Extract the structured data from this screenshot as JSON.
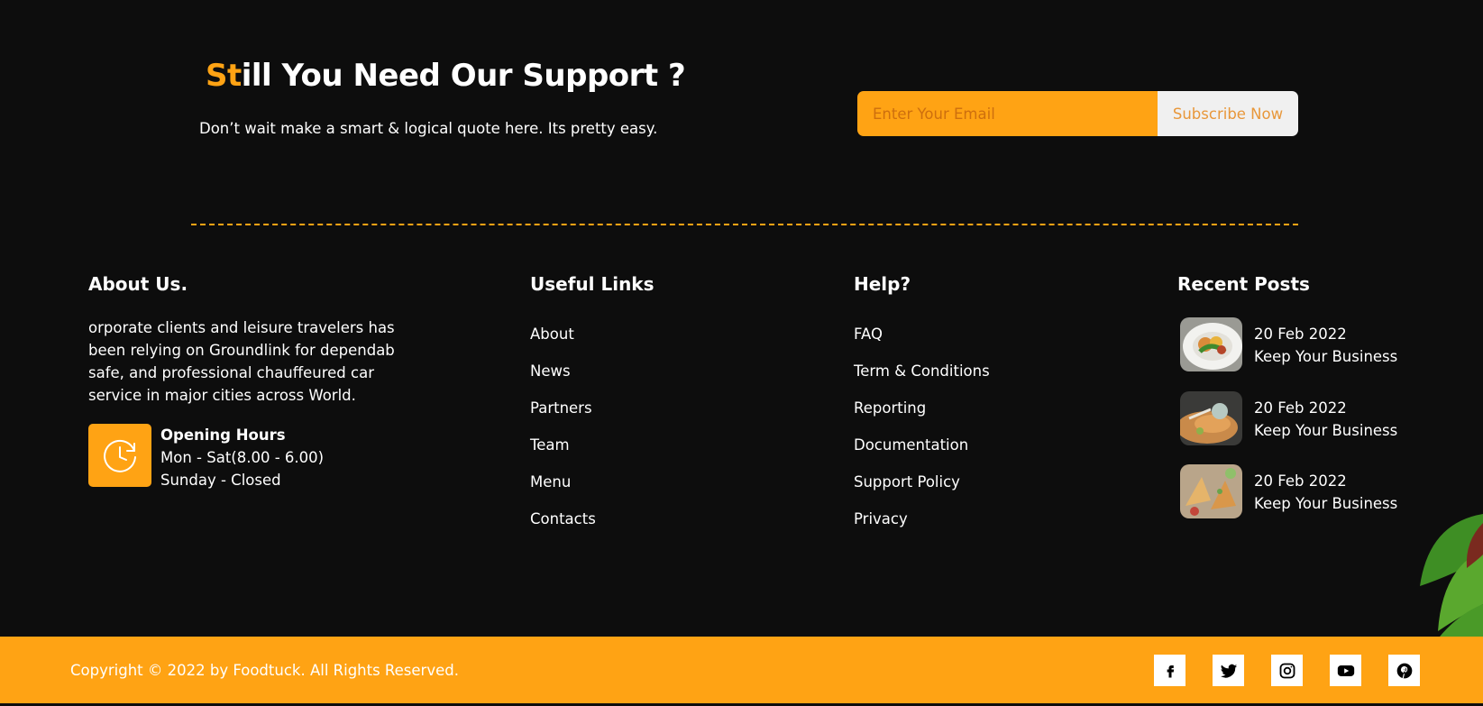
{
  "support": {
    "title_accent": "St",
    "title_rest": "ill You Need Our Support ?",
    "subtitle": "Don’t wait make a smart & logical quote here. Its pretty easy.",
    "email_placeholder": "Enter Your Email",
    "subscribe_label": "Subscribe Now"
  },
  "about": {
    "title": "About Us.",
    "text": "orporate clients and leisure travelers has been relying on Groundlink for dependab safe, and professional chauffeured car service in major cities across World.",
    "hours_title": "Opening Hours",
    "hours_weekdays": "Mon - Sat(8.00 - 6.00)",
    "hours_sunday": "Sunday - Closed"
  },
  "useful_links": {
    "title": "Useful Links",
    "items": [
      "About",
      "News",
      "Partners",
      "Team",
      "Menu",
      "Contacts"
    ]
  },
  "help": {
    "title": "Help?",
    "items": [
      "FAQ",
      "Term & Conditions",
      "Reporting",
      "Documentation",
      "Support Policy",
      "Privacy"
    ]
  },
  "recent_posts": {
    "title": "Recent Posts",
    "items": [
      {
        "date": "20 Feb 2022",
        "title": "Keep Your Business"
      },
      {
        "date": "20 Feb 2022",
        "title": "Keep Your Business"
      },
      {
        "date": "20 Feb 2022",
        "title": "Keep Your Business"
      }
    ]
  },
  "footer": {
    "copyright": "Copyright © 2022 by Foodtuck. All Rights Reserved.",
    "social_icons": [
      "facebook-icon",
      "twitter-icon",
      "instagram-icon",
      "youtube-icon",
      "pinterest-icon"
    ]
  },
  "colors": {
    "accent": "#ffa314",
    "background": "#0d0d0d",
    "text": "#ffffff"
  }
}
